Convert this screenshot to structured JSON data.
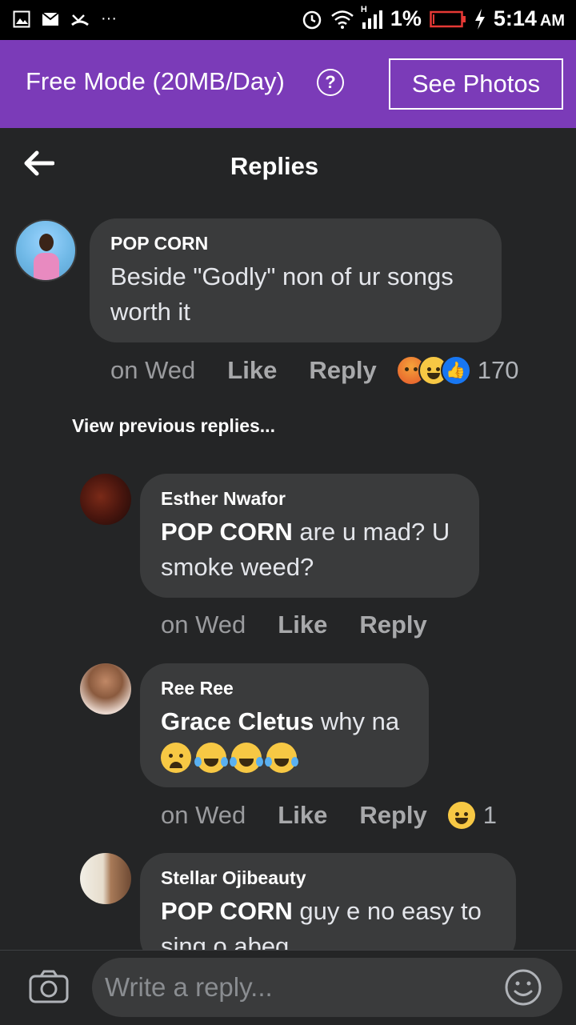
{
  "status_bar": {
    "battery": "1%",
    "time": "5:14",
    "ampm": "AM",
    "signal_label": "H"
  },
  "free_mode": {
    "text": "Free Mode (20MB/Day)",
    "help_glyph": "?",
    "see_photos": "See Photos"
  },
  "header": {
    "title": "Replies"
  },
  "main_comment": {
    "author": "POP CORN",
    "text": "Beside \"Godly\" non of ur songs worth it",
    "time": "on Wed",
    "like": "Like",
    "reply": "Reply",
    "reactions": [
      "angry",
      "haha",
      "like"
    ],
    "reaction_count": "170"
  },
  "view_previous": "View previous replies...",
  "replies": [
    {
      "author": "Esther Nwafor",
      "mention": "POP CORN",
      "text": " are u mad? U smoke weed?",
      "time": "on Wed",
      "like": "Like",
      "reply": "Reply"
    },
    {
      "author": "Ree Ree",
      "mention": "Grace Cletus",
      "text": " why na",
      "emojis": [
        "weary-face",
        "tears-of-joy",
        "tears-of-joy",
        "tears-of-joy"
      ],
      "time": "on Wed",
      "like": "Like",
      "reply": "Reply",
      "reactions": [
        "haha"
      ],
      "reaction_count": "1"
    },
    {
      "author": "Stellar Ojibeauty",
      "mention": "POP CORN",
      "text": " guy e no easy to sing o abeg"
    }
  ],
  "composer": {
    "placeholder": "Write a reply..."
  },
  "colors": {
    "brand_bar": "#7b3bb8",
    "background": "#242526",
    "bubble": "#3a3b3c"
  }
}
